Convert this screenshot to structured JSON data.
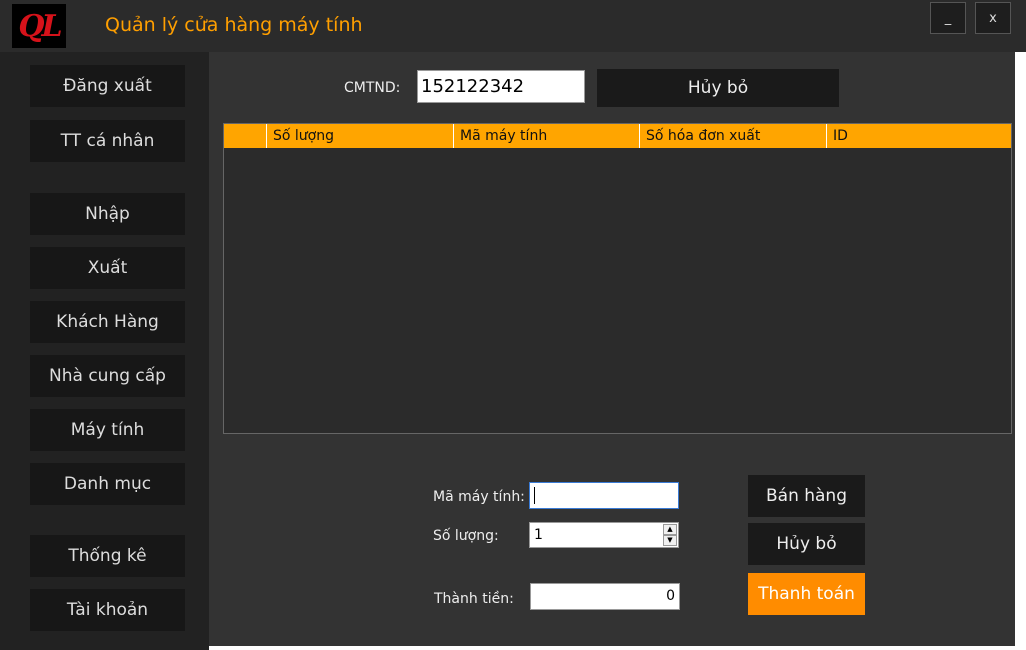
{
  "window": {
    "logo_text": "QL",
    "title": "Quản lý cửa hàng máy tính",
    "minimize_label": "_",
    "close_label": "x"
  },
  "sidebar": {
    "items": [
      {
        "label": "Đăng xuất"
      },
      {
        "label": "TT cá nhân"
      },
      {
        "label": "Nhập"
      },
      {
        "label": "Xuất"
      },
      {
        "label": "Khách Hàng"
      },
      {
        "label": "Nhà cung cấp"
      },
      {
        "label": "Máy tính"
      },
      {
        "label": "Danh mục"
      },
      {
        "label": "Thống kê"
      },
      {
        "label": "Tài khoản"
      }
    ]
  },
  "top_form": {
    "cmtnd_label": "CMTND:",
    "cmtnd_value": "152122342",
    "cancel_label": "Hủy bỏ"
  },
  "table": {
    "columns": [
      "Số lượng",
      "Mã máy tính",
      "Số hóa đơn xuất",
      "ID"
    ],
    "rows": []
  },
  "bottom_form": {
    "ma_may_tinh_label": "Mã máy tính:",
    "ma_may_tinh_value": "",
    "so_luong_label": "Số lượng:",
    "so_luong_value": "1",
    "thanh_tien_label": "Thành tiền:",
    "thanh_tien_value": "0",
    "sell_label": "Bán hàng",
    "cancel_label": "Hủy bỏ",
    "pay_label": "Thanh toán"
  },
  "colors": {
    "accent": "#ff9f00",
    "header_bg": "#ffa500",
    "pay_button": "#ff8c00"
  }
}
